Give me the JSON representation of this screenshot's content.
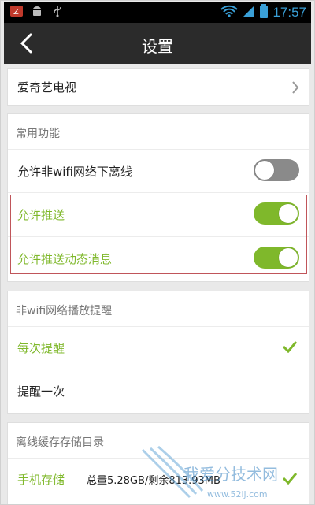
{
  "status_bar": {
    "time": "17:57"
  },
  "header": {
    "title": "设置"
  },
  "top_item": {
    "label": "爱奇艺电视"
  },
  "common": {
    "title": "常用功能",
    "items": [
      {
        "label": "允许非wifi网络下离线",
        "state": "off"
      },
      {
        "label": "允许推送",
        "state": "on"
      },
      {
        "label": "允许推送动态消息",
        "state": "on"
      }
    ]
  },
  "nonwifi": {
    "title": "非wifi网络播放提醒",
    "options": [
      {
        "label": "每次提醒",
        "selected": true
      },
      {
        "label": "提醒一次",
        "selected": false
      }
    ]
  },
  "storage": {
    "title": "离线缓存存储目录",
    "item": {
      "label": "手机存储",
      "info": "总量5.28GB/剩余813.93MB"
    }
  },
  "watermark": {
    "text": "我爱分技术网",
    "url": "www.52ij.com"
  },
  "colors": {
    "accent": "#7fb82b",
    "highlight_border": "#c0555a",
    "header_bg": "#2b2b2b"
  }
}
